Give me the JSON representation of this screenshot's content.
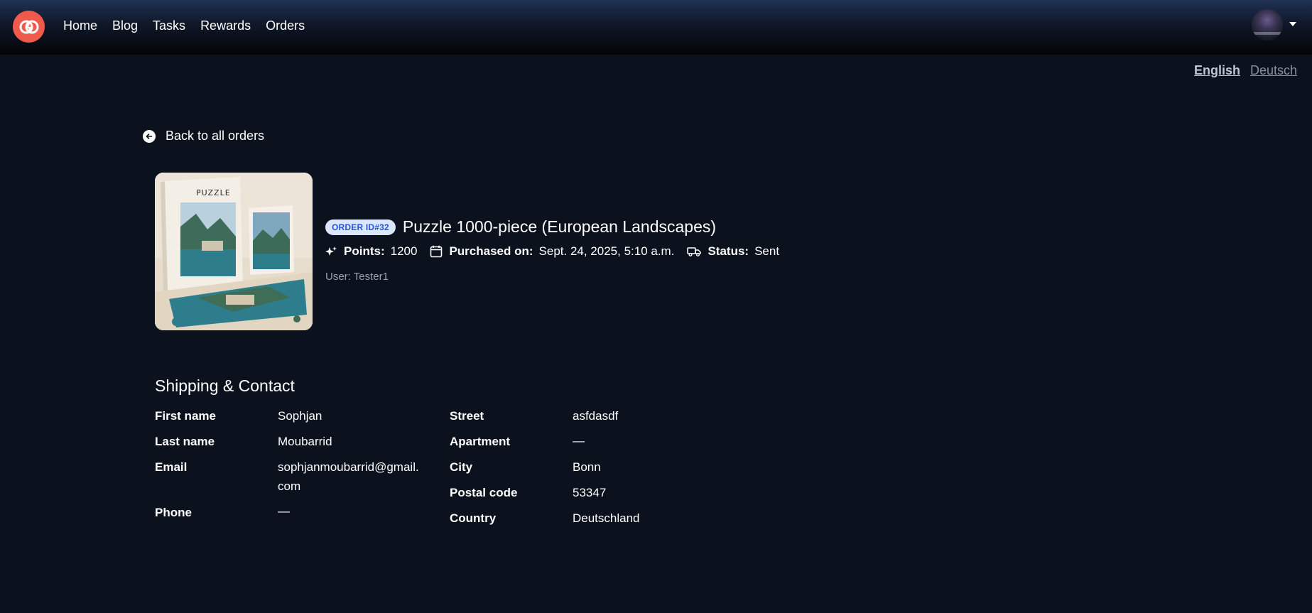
{
  "nav": {
    "links": [
      "Home",
      "Blog",
      "Tasks",
      "Rewards",
      "Orders"
    ]
  },
  "languages": {
    "english": "English",
    "deutsch": "Deutsch"
  },
  "back_link": {
    "label": "Back to all orders"
  },
  "order": {
    "badge": "ORDER ID#32",
    "title": "Puzzle 1000-piece (European Landscapes)",
    "points_label": "Points:",
    "points_value": "1200",
    "purchased_label": "Purchased on:",
    "purchased_value": "Sept. 24, 2025, 5:10 a.m.",
    "status_label": "Status:",
    "status_value": "Sent",
    "user": "User: Tester1",
    "image_text": "PUZZLE"
  },
  "shipping": {
    "title": "Shipping & Contact",
    "first_name_label": "First name",
    "first_name": "Sophjan",
    "last_name_label": "Last name",
    "last_name": "Moubarrid",
    "email_label": "Email",
    "email_line1": "sophjanmoubarrid@gmail.",
    "email_line2": "com",
    "phone_label": "Phone",
    "phone": "—",
    "street_label": "Street",
    "street": "asfdasdf",
    "apartment_label": "Apartment",
    "apartment": "—",
    "city_label": "City",
    "city": "Bonn",
    "postal_label": "Postal code",
    "postal": "53347",
    "country_label": "Country",
    "country": "Deutschland"
  },
  "colors": {
    "background": "#0b111d",
    "logo": "#ef5a4c",
    "badge_bg": "#dbe6ff",
    "badge_text": "#2757d8"
  },
  "icons": [
    "logo-icon",
    "avatar",
    "back-arrow-icon",
    "sparkle-icon",
    "calendar-icon",
    "truck-icon"
  ]
}
